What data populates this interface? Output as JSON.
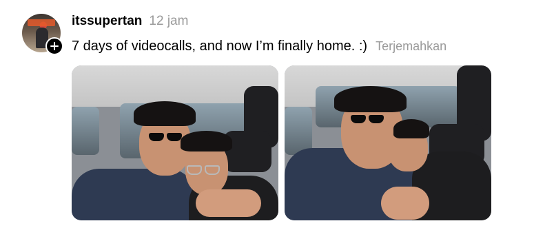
{
  "post": {
    "username": "itssupertan",
    "timestamp": "12 jam",
    "caption": "7 days of videocalls, and now I’m finally home. :)",
    "translate_label": "Terjemahkan",
    "photos": [
      {
        "alt_name": "selfie-photo-1"
      },
      {
        "alt_name": "selfie-photo-2"
      }
    ]
  },
  "icons": {
    "avatar_badge": "plus-icon"
  }
}
